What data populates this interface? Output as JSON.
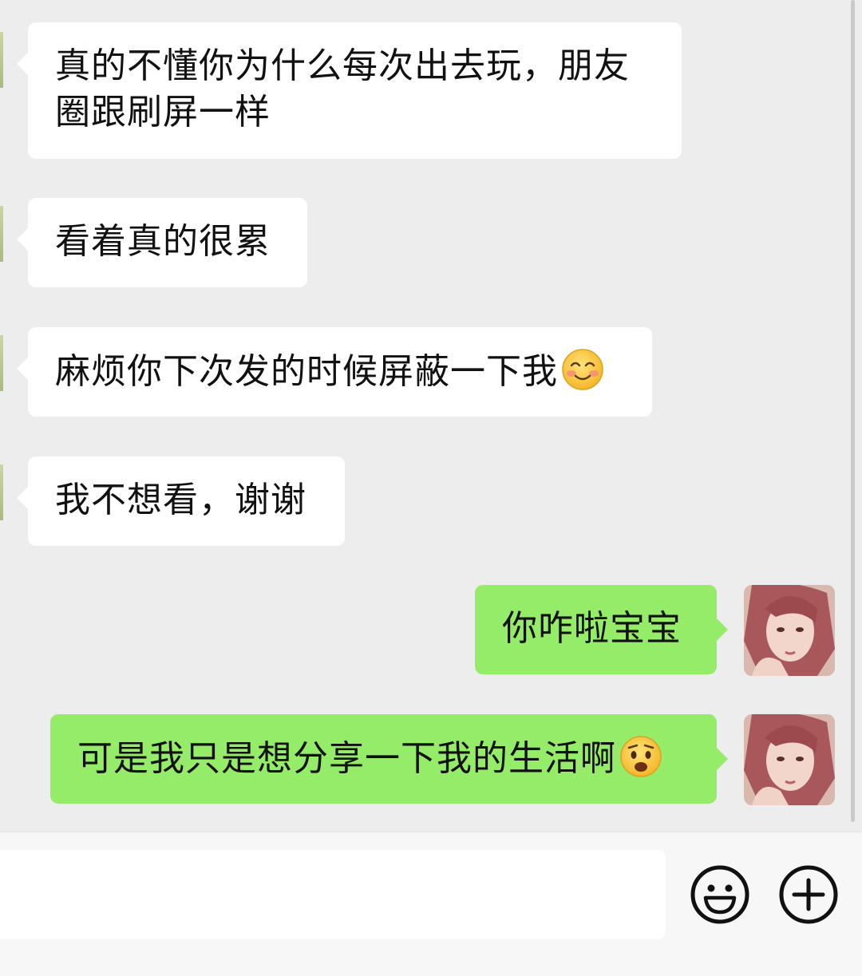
{
  "chat": {
    "messages": [
      {
        "from": "other",
        "text": "真的不懂你为什么每次出去玩，朋友圈跟刷屏一样"
      },
      {
        "from": "other",
        "text": "看着真的很累"
      },
      {
        "from": "other",
        "text": "麻烦你下次发的时候屏蔽一下我",
        "emoji": "smiling-blush-emoji"
      },
      {
        "from": "other",
        "text": "我不想看，谢谢"
      },
      {
        "from": "me",
        "text": "你咋啦宝宝"
      },
      {
        "from": "me",
        "text": "可是我只是想分享一下我的生活啊",
        "emoji": "anguished-face-emoji"
      }
    ]
  },
  "input_bar": {
    "text_value": "",
    "emoji_icon": "emoji-smiley-icon",
    "plus_icon": "plus-circle-icon"
  },
  "colors": {
    "background": "#ededed",
    "incoming_bubble": "#ffffff",
    "outgoing_bubble": "#95ec69"
  }
}
